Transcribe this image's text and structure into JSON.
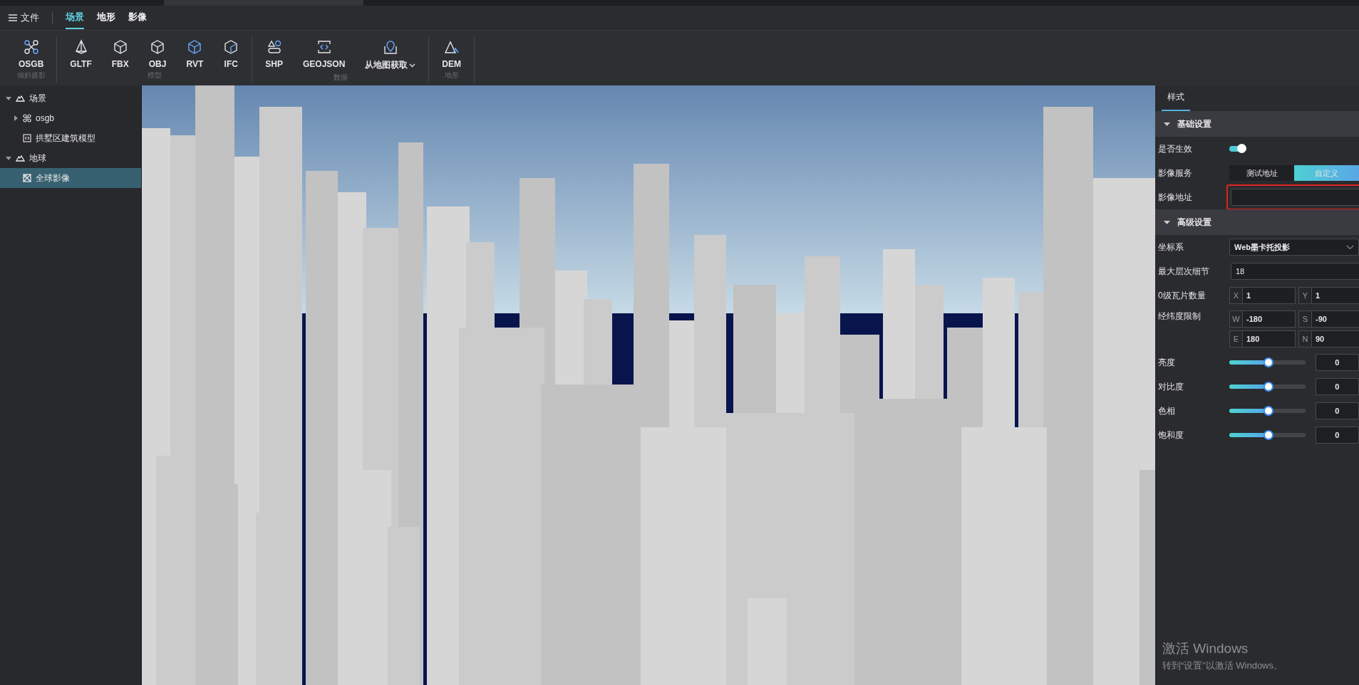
{
  "menu": {
    "file": "文件",
    "tabs": [
      {
        "label": "场景",
        "selected": true
      },
      {
        "label": "地形",
        "selected": false
      },
      {
        "label": "影像",
        "selected": false
      }
    ]
  },
  "toolbar": [
    {
      "label": "倾斜摄影",
      "items": [
        {
          "label": "OSGB",
          "dropdown": false
        }
      ]
    },
    {
      "label": "模型",
      "items": [
        {
          "label": "GLTF",
          "dropdown": false
        },
        {
          "label": "FBX",
          "dropdown": false
        },
        {
          "label": "OBJ",
          "dropdown": false
        },
        {
          "label": "RVT",
          "dropdown": false
        },
        {
          "label": "IFC",
          "dropdown": false
        }
      ]
    },
    {
      "label": "数据",
      "items": [
        {
          "label": "SHP",
          "dropdown": false
        },
        {
          "label": "GEOJSON",
          "dropdown": false
        },
        {
          "label": "从地图获取",
          "dropdown": true
        }
      ]
    },
    {
      "label": "地形",
      "items": [
        {
          "label": "DEM",
          "dropdown": false
        }
      ]
    }
  ],
  "tree": [
    {
      "label": "场景",
      "expanded": true,
      "selected": false,
      "children": [
        {
          "label": "osgb",
          "kind": "osgb",
          "expanded": false,
          "selected": false
        },
        {
          "label": "拱墅区建筑模型",
          "kind": "model",
          "selected": false
        }
      ]
    },
    {
      "label": "地球",
      "expanded": true,
      "selected": false,
      "children": [
        {
          "label": "全球影像",
          "kind": "imagery",
          "selected": true
        }
      ]
    }
  ],
  "panel": {
    "tabs": [
      {
        "label": "样式",
        "selected": true
      }
    ],
    "sections": [
      {
        "title": "基础设置",
        "expanded": true,
        "rows": [
          {
            "kind": "toggle",
            "label": "是否生效",
            "on": true
          },
          {
            "kind": "segmented",
            "label": "影像服务",
            "options": [
              {
                "label": "测试地址",
                "selected": false
              },
              {
                "label": "自定义",
                "selected": true
              }
            ]
          },
          {
            "kind": "input",
            "label": "影像地址",
            "highlighted": true
          }
        ]
      },
      {
        "title": "高级设置",
        "expanded": true,
        "rows": [
          {
            "kind": "select",
            "label": "坐标系",
            "value": "Web墨卡托投影"
          },
          {
            "kind": "input",
            "label": "最大层次细节",
            "value": "18"
          },
          {
            "kind": "pairs",
            "label": "0级瓦片数量",
            "fields": [
              {
                "prefix": "X",
                "value": "1"
              },
              {
                "prefix": "Y",
                "value": "1"
              }
            ]
          },
          {
            "kind": "pairs",
            "label": "经纬度限制",
            "fields": [
              {
                "prefix": "W",
                "value": "-180"
              },
              {
                "prefix": "S",
                "value": "-90"
              },
              {
                "prefix": "E",
                "value": "180"
              },
              {
                "prefix": "N",
                "value": "90"
              }
            ]
          },
          {
            "kind": "slider",
            "label": "亮度",
            "level": 0.52,
            "value": "0"
          },
          {
            "kind": "slider",
            "label": "对比度",
            "level": 0.52,
            "value": "0"
          },
          {
            "kind": "slider",
            "label": "色相",
            "level": 0.52,
            "value": "0"
          },
          {
            "kind": "slider",
            "label": "饱和度",
            "level": 0.52,
            "value": "0"
          }
        ]
      }
    ]
  },
  "os_notice": {
    "title": "激活 Windows",
    "text": "转到“设置”以激活 Windows。"
  }
}
